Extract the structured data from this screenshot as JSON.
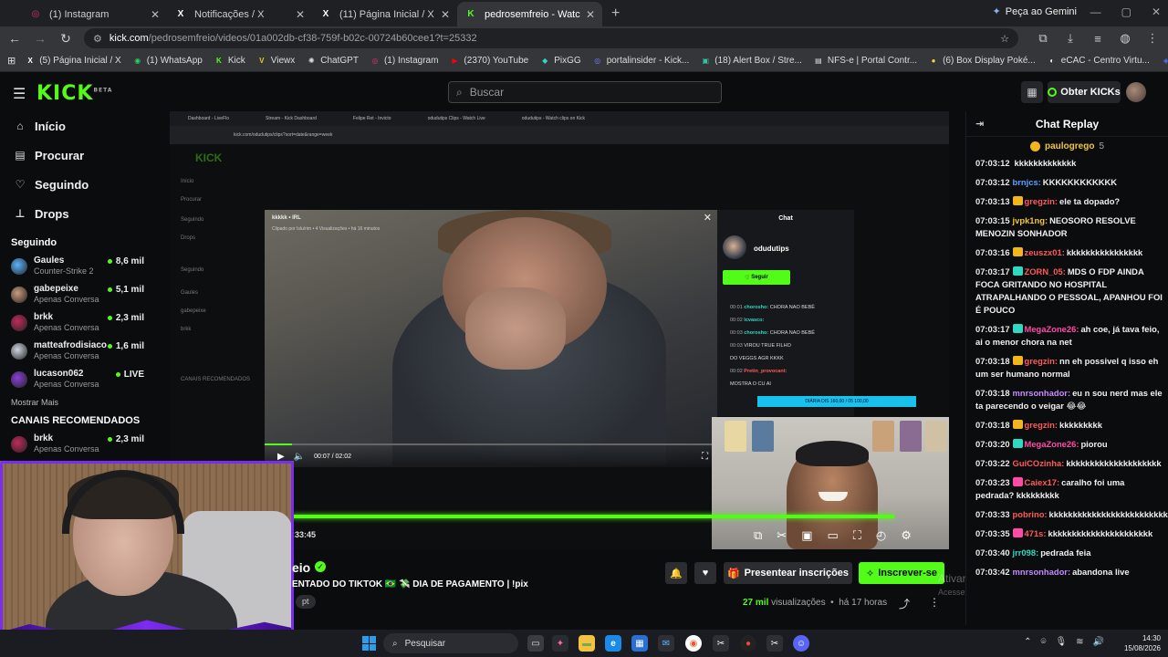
{
  "browser": {
    "tabs": [
      {
        "title": "(1) Instagram",
        "icon": "instagram-icon",
        "color": "#e1306c",
        "glyph": "◎"
      },
      {
        "title": "Notificações / X",
        "icon": "x-icon",
        "color": "#ffffff",
        "glyph": "X"
      },
      {
        "title": "(11) Página Inicial / X",
        "icon": "x-icon",
        "color": "#ffffff",
        "glyph": "X"
      },
      {
        "title": "pedrosemfreio - Watch the VOD",
        "icon": "kick-icon",
        "color": "#53fc18",
        "glyph": "K",
        "active": true
      }
    ],
    "gemini_label": "Peça ao Gemini",
    "url_domain": "kick.com",
    "url_path": "/pedrosemfreio/videos/01a002db-cf38-759f-b02c-00724b60cee1?t=25332",
    "bookmarks": [
      {
        "label": "(5) Página Inicial / X",
        "color": "#ffffff",
        "glyph": "X"
      },
      {
        "label": "(1) WhatsApp",
        "color": "#25d366",
        "glyph": "◉"
      },
      {
        "label": "Kick",
        "color": "#53fc18",
        "glyph": "K"
      },
      {
        "label": "Viewx",
        "color": "#f5c518",
        "glyph": "V"
      },
      {
        "label": "ChatGPT",
        "color": "#dddddd",
        "glyph": "✺"
      },
      {
        "label": "(1) Instagram",
        "color": "#e1306c",
        "glyph": "◎"
      },
      {
        "label": "(2370) YouTube",
        "color": "#ff0000",
        "glyph": "▶"
      },
      {
        "label": "PixGG",
        "color": "#2ed8c3",
        "glyph": "◆"
      },
      {
        "label": "portalinsider - Kick...",
        "color": "#7a7cff",
        "glyph": "◎"
      },
      {
        "label": "(18) Alert Box / Stre...",
        "color": "#31c3a2",
        "glyph": "▣"
      },
      {
        "label": "NFS-e | Portal Contr...",
        "color": "#dddddd",
        "glyph": "▤"
      },
      {
        "label": "(6) Box Display Poké...",
        "color": "#f5d33b",
        "glyph": "●"
      },
      {
        "label": "eCAC - Centro Virtu...",
        "color": "#ffffff",
        "glyph": "◐"
      },
      {
        "label": "Serviços da Receita...",
        "color": "#4a74ff",
        "glyph": "◈"
      }
    ]
  },
  "kick": {
    "logo": "KICK",
    "logo_sup": "BETA",
    "search_placeholder": "Buscar",
    "kicks_button": "Obter KICKs"
  },
  "sidebar": {
    "nav": [
      {
        "label": "Início",
        "icon": "home-icon",
        "glyph": "⌂"
      },
      {
        "label": "Procurar",
        "icon": "browse-icon",
        "glyph": "▤"
      },
      {
        "label": "Seguindo",
        "icon": "heart-icon",
        "glyph": "♡"
      },
      {
        "label": "Drops",
        "icon": "drops-icon",
        "glyph": "⊥"
      }
    ],
    "following_title": "Seguindo",
    "following": [
      {
        "name": "Gaules",
        "game": "Counter-Strike 2",
        "viewers": "8,6 mil",
        "color": "#5ab4ff"
      },
      {
        "name": "gabepeixe",
        "game": "Apenas Conversa",
        "viewers": "5,1 mil",
        "color": "#c99a7e"
      },
      {
        "name": "brkk",
        "game": "Apenas Conversa",
        "viewers": "2,3 mil",
        "color": "#c02a5a"
      },
      {
        "name": "matteafrodisiaco",
        "game": "Apenas Conversa",
        "viewers": "1,6 mil",
        "color": "#cfd6e0"
      },
      {
        "name": "lucason062",
        "game": "Apenas Conversa",
        "viewers": "LIVE",
        "color": "#8a3fd6"
      }
    ],
    "show_more": "Mostrar Mais",
    "recommended_title": "CANAIS RECOMENDADOS",
    "recommended": [
      {
        "name": "brkk",
        "game": "Apenas Conversa",
        "viewers": "2,3 mil",
        "color": "#c02a5a"
      }
    ]
  },
  "inner_clip": {
    "title": "kkkkk • IRL",
    "subtitle": "Clipado por Islu/rim • 4 Visualizações • há 16 minutos",
    "time": "00:07 / 02:02",
    "progress": 0.06,
    "chat_title": "Chat",
    "channel": "odudutips",
    "follow": "Seguir",
    "messages": [
      {
        "t": "00:01",
        "u": "chorosho:",
        "text": "CHORA NAO BEBÊ",
        "uc": "u"
      },
      {
        "t": "00:02",
        "u": "lcvasco:",
        "text": "",
        "uc": "u"
      },
      {
        "t": "00:03",
        "u": "chorosho:",
        "text": "CHORA NAO BEBÊ",
        "uc": "u"
      },
      {
        "t": "00:03",
        "u": "",
        "text": "VIROU TRUE FILHO",
        "uc": "r"
      },
      {
        "t": "",
        "u": "",
        "text": "DO VEGGS AGR KKKK",
        "uc": "u"
      },
      {
        "t": "00:02",
        "u": "Pretin_provocant:",
        "text": "",
        "uc": "r"
      },
      {
        "t": "",
        "u": "",
        "text": "MOSTRA O CU AI",
        "uc": "u"
      }
    ],
    "goal": "DIÁRIA DIS 160,00 / 05 100,00"
  },
  "player": {
    "time": ":33:45"
  },
  "stream": {
    "title_fragment": "eio",
    "subtitle": "ENTADO DO TIKTOK 🇧🇷 💸 DIA DE PAGAMENTO | !pix",
    "lang": "pt",
    "gift_label": "Presentear inscrições",
    "subscribe_label": "Inscrever-se",
    "views_count": "27 mil",
    "views_label": "visualizações",
    "age": "há 17 horas",
    "activate1": "Ativar o Windows",
    "activate2": "Acesse Configurações para ativar o Windows."
  },
  "chat": {
    "title": "Chat Replay",
    "pinned_user": "paulogrego",
    "pinned_count": "5",
    "messages": [
      {
        "time": "07:03:12",
        "user": "",
        "text": "kkkkkkkkkkkkk",
        "color": "#ff5a5a",
        "badge": ""
      },
      {
        "time": "07:03:12",
        "user": "brnjcs:",
        "text": "KKKKKKKKKKKK",
        "color": "#5aa0ff",
        "badge": ""
      },
      {
        "time": "07:03:13",
        "user": "gregzin:",
        "text": "ele ta dopado?",
        "color": "#ff5a5a",
        "badge": "#f2b51b"
      },
      {
        "time": "07:03:15",
        "user": "jvpk1ng:",
        "text": "NEOSORO RESOLVE MENOZIN SONHADOR",
        "color": "#f2c53d",
        "badge": ""
      },
      {
        "time": "07:03:16",
        "user": "zeuszx01:",
        "text": "kkkkkkkkkkkkkkkk",
        "color": "#ff5a5a",
        "badge": "#f2b51b"
      },
      {
        "time": "07:03:17",
        "user": "ZORN_05:",
        "text": "MDS O FDP AINDA FOCA GRITANDO NO HOSPITAL ATRAPALHANDO O PESSOAL, APANHOU FOI É POUCO",
        "color": "#ff5a5a",
        "badge": "#2ed8c3"
      },
      {
        "time": "07:03:17",
        "user": "MegaZone26:",
        "text": "ah coe, já tava feio, ai o menor chora na net",
        "color": "#ff4aa8",
        "badge": "#2ed8c3"
      },
      {
        "time": "07:03:18",
        "user": "gregzin:",
        "text": "nn eh possivel q isso eh um ser humano normal",
        "color": "#ff5a5a",
        "badge": "#f2b51b"
      },
      {
        "time": "07:03:18",
        "user": "mnrsonhador:",
        "text": "eu n sou nerd mas ele ta parecendo o veigar 😂😂",
        "color": "#c58bff",
        "badge": ""
      },
      {
        "time": "07:03:18",
        "user": "gregzin:",
        "text": "kkkkkkkkk",
        "color": "#ff5a5a",
        "badge": "#f2b51b"
      },
      {
        "time": "07:03:20",
        "user": "MegaZone26:",
        "text": "piorou",
        "color": "#ff4aa8",
        "badge": "#2ed8c3"
      },
      {
        "time": "07:03:22",
        "user": "GuiCOzinha:",
        "text": "kkkkkkkkkkkkkkkkkkkk",
        "color": "#ff5a5a",
        "badge": ""
      },
      {
        "time": "07:03:23",
        "user": "Caiex17:",
        "text": "caralho foi uma pedrada? kkkkkkkkk",
        "color": "#ff5a5a",
        "badge": "#ff4aa8"
      },
      {
        "time": "07:03:33",
        "user": "pobrino:",
        "text": "kkkkkkkkkkkkkkkkkkkkkkkkkkkkkkk",
        "color": "#ff5a5a",
        "badge": ""
      },
      {
        "time": "07:03:35",
        "user": "471s:",
        "text": "kkkkkkkkkkkkkkkkkkkkkk",
        "color": "#ff5a5a",
        "badge": "#ff4aa8"
      },
      {
        "time": "07:03:40",
        "user": "jrr098:",
        "text": "pedrada feia",
        "color": "#2ed8c3",
        "badge": ""
      },
      {
        "time": "07:03:42",
        "user": "mnrsonhador:",
        "text": "abandona live",
        "color": "#c58bff",
        "badge": ""
      }
    ]
  },
  "taskbar": {
    "search": "Pesquisar",
    "time": "14:30",
    "date": "15/08/2026"
  }
}
